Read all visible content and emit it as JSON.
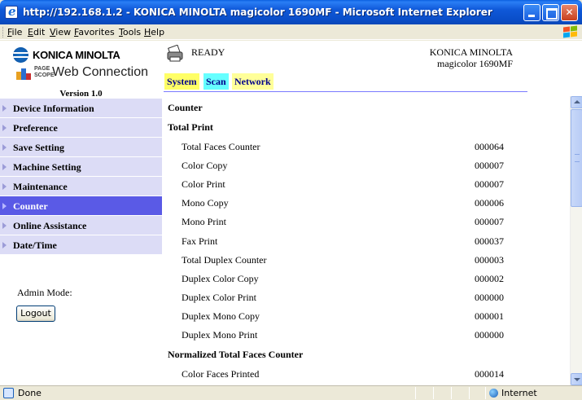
{
  "window": {
    "title": "http://192.168.1.2 - KONICA MINOLTA magicolor 1690MF - Microsoft Internet Explorer"
  },
  "menu": [
    "File",
    "Edit",
    "View",
    "Favorites",
    "Tools",
    "Help"
  ],
  "left": {
    "brand_name": "KONICA MINOLTA",
    "pagescope_word": "PAGE SCOPE",
    "web_connection": "Web Connection",
    "version": "Version 1.0",
    "nav_items": [
      {
        "label": "Device Information",
        "active": false
      },
      {
        "label": "Preference",
        "active": false
      },
      {
        "label": "Save Setting",
        "active": false
      },
      {
        "label": "Machine Setting",
        "active": false
      },
      {
        "label": "Maintenance",
        "active": false
      },
      {
        "label": "Counter",
        "active": true
      },
      {
        "label": "Online Assistance",
        "active": false
      },
      {
        "label": "Date/Time",
        "active": false
      }
    ],
    "admin_mode_label": "Admin Mode:",
    "logout_label": "Logout"
  },
  "header": {
    "status": "READY",
    "maker": "KONICA MINOLTA",
    "model": "magicolor 1690MF"
  },
  "tabs": [
    "System",
    "Scan",
    "Network"
  ],
  "counter": {
    "page_title": "Counter",
    "total_print_title": "Total Print",
    "rows": [
      {
        "label": "Total Faces Counter",
        "value": "000064"
      },
      {
        "label": "Color Copy",
        "value": "000007"
      },
      {
        "label": "Color Print",
        "value": "000007"
      },
      {
        "label": "Mono Copy",
        "value": "000006"
      },
      {
        "label": "Mono Print",
        "value": "000007"
      },
      {
        "label": "Fax Print",
        "value": "000037"
      },
      {
        "label": "Total Duplex Counter",
        "value": "000003"
      },
      {
        "label": "Duplex Color Copy",
        "value": "000002"
      },
      {
        "label": "Duplex Color Print",
        "value": "000000"
      },
      {
        "label": "Duplex Mono Copy",
        "value": "000001"
      },
      {
        "label": "Duplex Mono Print",
        "value": "000000"
      }
    ],
    "normalized_title": "Normalized Total Faces Counter",
    "normalized_rows": [
      {
        "label": "Color Faces Printed",
        "value": "000014"
      }
    ]
  },
  "statusbar": {
    "left_text": "Done",
    "zone": "Internet"
  },
  "colors": {
    "nav_bg": "#dcdcf6",
    "nav_active": "#5a5ae6",
    "tab_system": "#ffff66",
    "tab_scan": "#66ffff",
    "tab_network": "#ffff99"
  }
}
